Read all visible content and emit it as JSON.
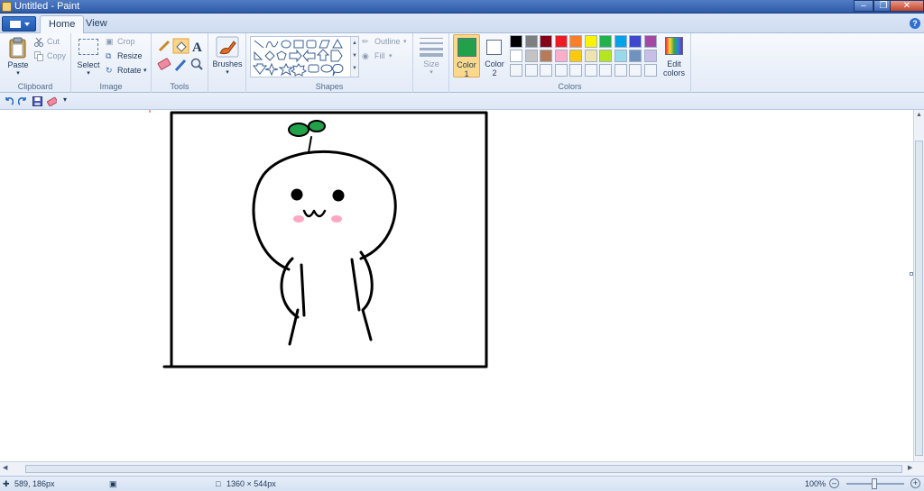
{
  "window": {
    "title": "Untitled - Paint"
  },
  "tabs": [
    "Home",
    "View"
  ],
  "ribbon": {
    "clipboard": {
      "label": "Clipboard",
      "paste": "Paste",
      "cut": "Cut",
      "copy": "Copy"
    },
    "image": {
      "label": "Image",
      "select": "Select",
      "crop": "Crop",
      "resize": "Resize",
      "rotate": "Rotate"
    },
    "tools": {
      "label": "Tools"
    },
    "brushes": {
      "label": "Brushes"
    },
    "shapes": {
      "label": "Shapes",
      "outline": "Outline",
      "fill": "Fill"
    },
    "size": {
      "label": "Size"
    },
    "colors": {
      "label": "Colors",
      "color1": "Color\n1",
      "color1_a": "Color",
      "color1_b": "1",
      "color2_a": "Color",
      "color2_b": "2",
      "edit_a": "Edit",
      "edit_b": "colors",
      "color1_value": "#22a14a",
      "color2_value": "#ffffff",
      "palette_row1": [
        "#000000",
        "#7f7f7f",
        "#880015",
        "#ed1c24",
        "#ff7f27",
        "#fff200",
        "#22b14c",
        "#00a2e8",
        "#3f48cc",
        "#a349a4"
      ],
      "palette_row2": [
        "#ffffff",
        "#c3c3c3",
        "#b97a57",
        "#ffaec9",
        "#ffc90e",
        "#efe4b0",
        "#b5e61d",
        "#99d9ea",
        "#7092be",
        "#c8bfe7"
      ]
    }
  },
  "status": {
    "cursor_pos": "589, 186px",
    "canvas_size": "1360 × 544px",
    "zoom": "100%"
  },
  "drawing": {
    "accent_green": "#22a14a",
    "blush": "#ff9fbf"
  }
}
